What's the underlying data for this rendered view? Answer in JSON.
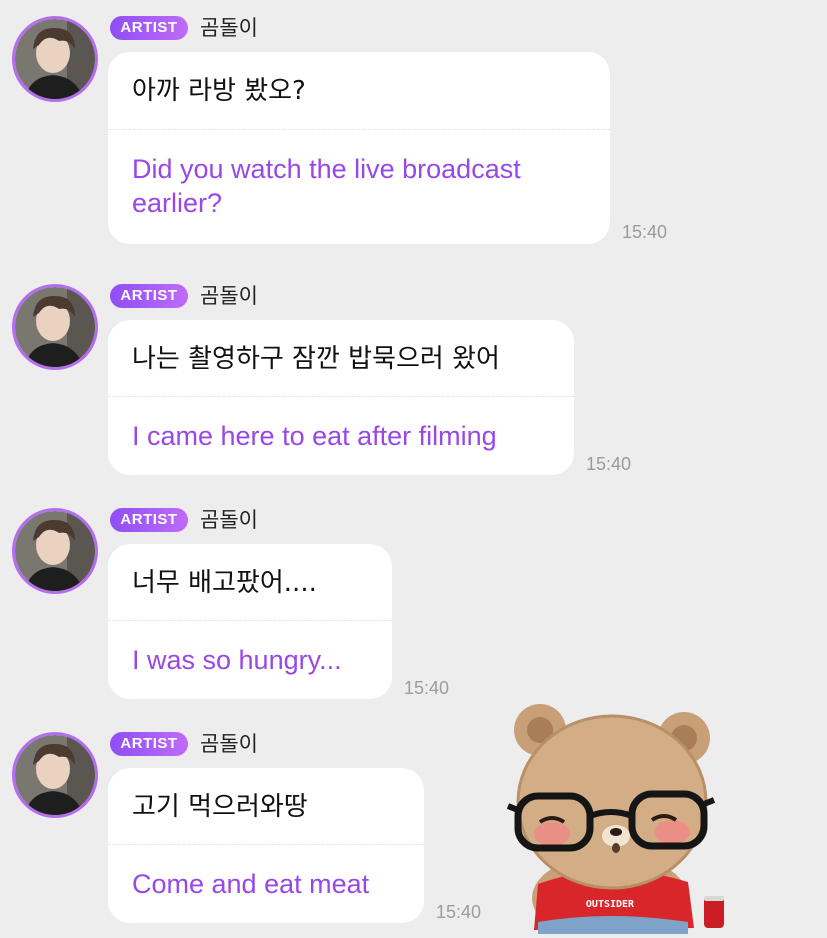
{
  "messages": [
    {
      "badge": "ARTIST",
      "sender": "곰돌이",
      "original": "아까 라방 봤오?",
      "translation": "Did you watch the live broadcast earlier?",
      "time": "15:40"
    },
    {
      "badge": "ARTIST",
      "sender": "곰돌이",
      "original": "나는 촬영하구 잠깐 밥묵으러 왔어",
      "translation": "I came here to eat after filming",
      "time": "15:40"
    },
    {
      "badge": "ARTIST",
      "sender": "곰돌이",
      "original": "너무 배고팠어....",
      "translation": "I was so hungry...",
      "time": "15:40"
    },
    {
      "badge": "ARTIST",
      "sender": "곰돌이",
      "original": "고기 먹으러와땅",
      "translation": "Come and eat meat",
      "time": "15:40"
    }
  ],
  "sticker": {
    "shirt_text": "OUTSIDER",
    "icon": "bear-sticker-icon"
  },
  "colors": {
    "accent": "#9848e8",
    "badge_start": "#8e4ef5",
    "badge_end": "#c16bf6",
    "background": "#ededed"
  }
}
